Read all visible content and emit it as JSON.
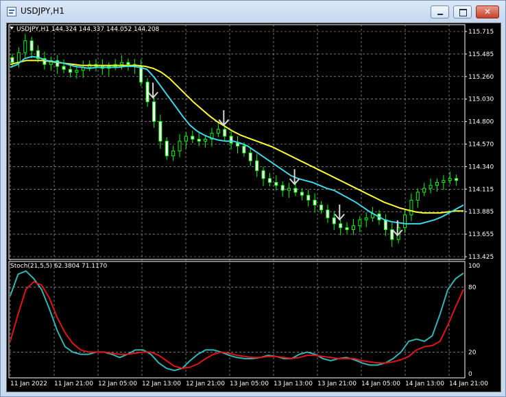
{
  "window": {
    "title": "USDJPY,H1",
    "icons": [
      "chart-window-icon",
      "minimize-icon",
      "maximize-icon",
      "close-icon"
    ],
    "close_glyph": "✕"
  },
  "colors": {
    "background": "#000000",
    "grid": "#c0c0c0",
    "bull_candle": "#00ff00",
    "bear_candle": "#ffffff",
    "ma_fast": "#3fd7e8",
    "ma_slow": "#ffff33",
    "stoch_main": "#33b5b5",
    "stoch_signal": "#e01515",
    "arrow": "#d8d8d8"
  },
  "price_panel": {
    "header": "USDJPY,H1  144.324 144.337 144.052 144.208",
    "price_labels": [
      "115.715",
      "115.485",
      "115.260",
      "115.030",
      "114.800",
      "114.570",
      "114.340",
      "114.115",
      "113.885",
      "113.655",
      "113.425"
    ]
  },
  "stoch_panel": {
    "header": "Stoch(21,5,5) 62.3804 71.1170",
    "level_labels": [
      "100",
      "80",
      "20",
      "0"
    ]
  },
  "time_axis": {
    "labels": [
      "11 Jan 2022",
      "11 Jan 21:00",
      "12 Jan 05:00",
      "12 Jan 13:00",
      "12 Jan 21:00",
      "13 Jan 05:00",
      "13 Jan 13:00",
      "13 Jan 21:00",
      "14 Jan 05:00",
      "14 Jan 13:00",
      "14 Jan 21:00"
    ]
  },
  "chart_data": [
    {
      "type": "candlestick",
      "title": "USDJPY,H1",
      "y_range": [
        113.425,
        115.715
      ],
      "price_series": [
        115.4,
        115.5,
        115.62,
        115.52,
        115.44,
        115.38,
        115.42,
        115.36,
        115.33,
        115.3,
        115.32,
        115.35,
        115.38,
        115.36,
        115.34,
        115.36,
        115.38,
        115.4,
        115.38,
        115.36,
        115.2,
        115.0,
        114.8,
        114.6,
        114.45,
        114.5,
        114.6,
        114.65,
        114.62,
        114.6,
        114.62,
        114.68,
        114.72,
        114.65,
        114.58,
        114.55,
        114.48,
        114.4,
        114.3,
        114.22,
        114.18,
        114.15,
        114.1,
        114.12,
        114.08,
        114.05,
        114.0,
        113.95,
        113.9,
        113.82,
        113.76,
        113.72,
        113.7,
        113.74,
        113.8,
        113.82,
        113.86,
        113.8,
        113.7,
        113.6,
        113.72,
        113.85,
        114.0,
        114.08,
        114.12,
        114.15,
        114.18,
        114.2,
        114.22,
        114.2
      ],
      "arrow_markers": 6,
      "ma_fast_series": [
        115.35,
        115.38,
        115.44,
        115.46,
        115.45,
        115.42,
        115.41,
        115.4,
        115.38,
        115.36,
        115.35,
        115.34,
        115.35,
        115.35,
        115.35,
        115.35,
        115.36,
        115.36,
        115.35,
        115.33,
        115.25,
        115.15,
        115.05,
        114.95,
        114.85,
        114.76,
        114.7,
        114.66,
        114.63,
        114.61,
        114.6,
        114.6,
        114.58,
        114.55,
        114.5,
        114.45,
        114.4,
        114.35,
        114.3,
        114.25,
        114.22,
        114.2,
        114.18,
        114.15,
        114.12,
        114.1,
        114.06,
        114.02,
        113.98,
        113.93,
        113.88,
        113.84,
        113.8,
        113.78,
        113.77,
        113.76,
        113.76,
        113.76,
        113.78,
        113.8,
        113.83,
        113.87,
        113.91,
        113.95
      ],
      "ma_slow_series": [
        115.38,
        115.4,
        115.42,
        115.42,
        115.42,
        115.41,
        115.4,
        115.39,
        115.38,
        115.37,
        115.37,
        115.37,
        115.37,
        115.37,
        115.37,
        115.37,
        115.37,
        115.36,
        115.34,
        115.3,
        115.24,
        115.16,
        115.08,
        115.0,
        114.93,
        114.86,
        114.8,
        114.75,
        114.7,
        114.66,
        114.63,
        114.6,
        114.57,
        114.54,
        114.5,
        114.46,
        114.42,
        114.38,
        114.34,
        114.3,
        114.26,
        114.22,
        114.18,
        114.14,
        114.1,
        114.06,
        114.02,
        113.98,
        113.95,
        113.92,
        113.9,
        113.88,
        113.87,
        113.87,
        113.87,
        113.88,
        113.89,
        113.89
      ]
    },
    {
      "type": "line",
      "title": "Stoch(21,5,5) 62.3804 71.1170",
      "y_range": [
        0,
        100
      ],
      "levels": [
        80,
        20
      ],
      "series": [
        {
          "name": "main",
          "values": [
            72,
            92,
            95,
            88,
            78,
            60,
            40,
            25,
            20,
            18,
            18,
            20,
            20,
            18,
            15,
            18,
            22,
            22,
            18,
            10,
            5,
            3,
            5,
            12,
            18,
            22,
            22,
            20,
            17,
            15,
            14,
            14,
            15,
            17,
            16,
            14,
            14,
            18,
            20,
            18,
            14,
            12,
            14,
            15,
            13,
            10,
            8,
            8,
            10,
            14,
            20,
            30,
            32,
            30,
            35,
            55,
            78,
            88,
            93
          ]
        },
        {
          "name": "signal",
          "values": [
            30,
            55,
            78,
            85,
            82,
            70,
            52,
            38,
            28,
            22,
            20,
            20,
            20,
            19,
            18,
            18,
            19,
            20,
            20,
            17,
            12,
            7,
            5,
            6,
            9,
            14,
            18,
            20,
            19,
            17,
            16,
            15,
            15,
            16,
            16,
            15,
            14,
            15,
            17,
            17,
            16,
            15,
            14,
            14,
            14,
            12,
            11,
            10,
            10,
            11,
            13,
            16,
            22,
            25,
            26,
            30,
            45,
            62,
            78
          ]
        }
      ]
    }
  ]
}
